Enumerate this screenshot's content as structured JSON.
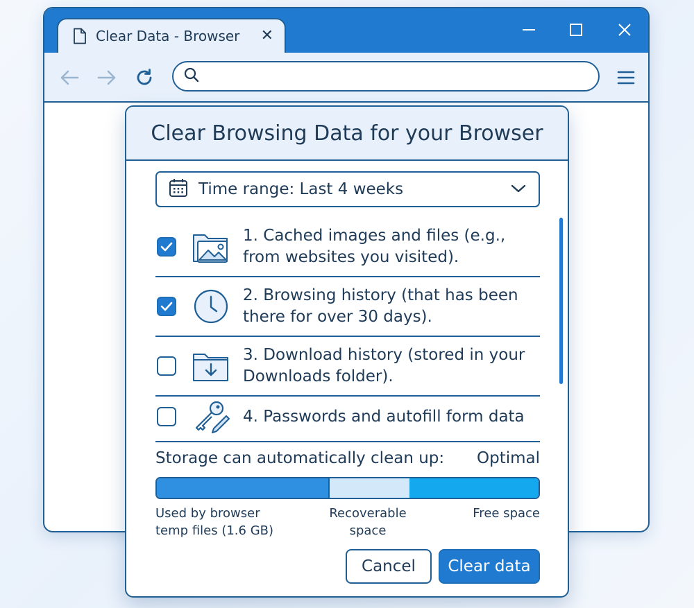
{
  "window": {
    "tab_title": "Clear Data - Browser",
    "tab_close": "✕",
    "url_value": "",
    "url_placeholder": "",
    "icons": {
      "doc": "document-icon",
      "minimize": "minimize-icon",
      "maximize": "maximize-icon",
      "close": "close-icon",
      "back": "arrow-left-icon",
      "forward": "arrow-right-icon",
      "reload": "reload-icon",
      "search": "search-icon",
      "menu": "menu-icon"
    }
  },
  "dialog": {
    "title": "Clear Browsing Data for your Browser",
    "time_range": "Time range: Last 4 weeks",
    "options": [
      {
        "label": "1. Cached images and files (e.g., from websites you visited).",
        "checked": true,
        "icon": "image-folder-icon"
      },
      {
        "label": "2. Browsing history (that has been there for over 30 days).",
        "checked": true,
        "icon": "clock-icon"
      },
      {
        "label": "3. Download history (stored in your Downloads folder).",
        "checked": false,
        "icon": "download-folder-icon"
      },
      {
        "label": "4. Passwords and autofill form data",
        "checked": false,
        "icon": "key-pencil-icon"
      }
    ],
    "storage": {
      "heading": "Storage can automatically clean up:",
      "status": "Optimal",
      "segments": [
        {
          "label": "Used by browser temp files (1.6 GB)",
          "fraction": 0.45
        },
        {
          "label": "Recoverable space",
          "fraction": 0.21
        },
        {
          "label": "Free space",
          "fraction": 0.34
        }
      ]
    },
    "buttons": {
      "cancel": "Cancel",
      "clear": "Clear data"
    }
  },
  "colors": {
    "accent": "#1f7ad0",
    "outline": "#1f5f95",
    "light": "#e8f1fb",
    "text": "#1f3b57"
  }
}
